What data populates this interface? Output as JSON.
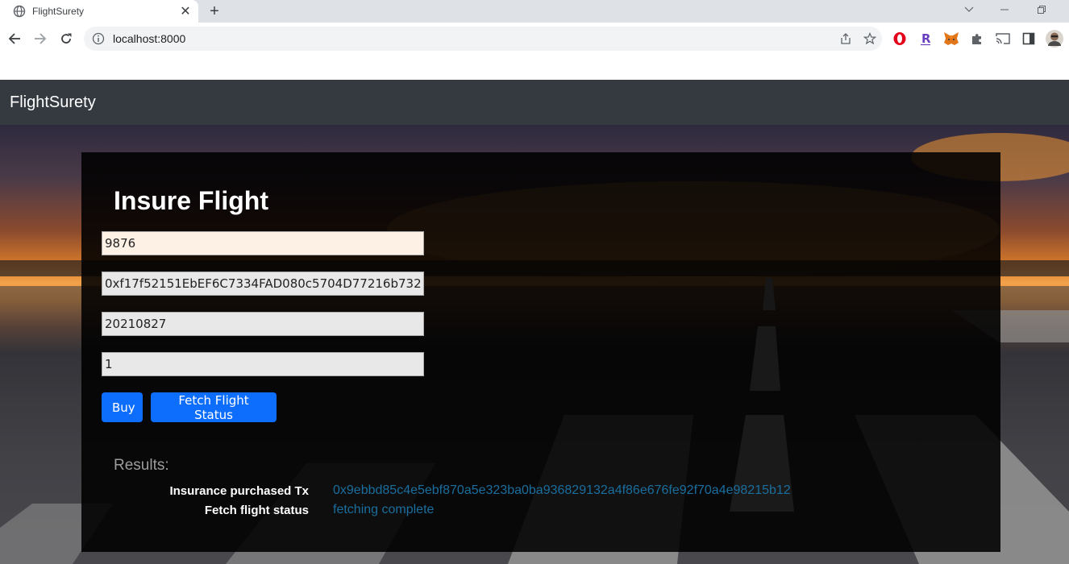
{
  "browser": {
    "tab_title": "FlightSurety",
    "url": "localhost:8000",
    "icons": [
      "globe-icon",
      "close-icon",
      "plus-icon",
      "back-icon",
      "forward-icon",
      "reload-icon",
      "info-icon",
      "share-icon",
      "star-icon",
      "opera-icon",
      "r-extension-icon",
      "metamask-icon",
      "puzzle-icon",
      "cast-icon",
      "sidepanel-icon",
      "profile-avatar"
    ]
  },
  "navbar": {
    "brand": "FlightSurety"
  },
  "form": {
    "title": "Insure Flight",
    "fields": {
      "flight": "9876",
      "airline": "0xf17f52151EbEF6C7334FAD080c5704D77216b732",
      "date": "20210827",
      "amount": "1"
    },
    "buy_label": "Buy",
    "fetch_label": "Fetch Flight Status"
  },
  "results": {
    "title": "Results:",
    "rows": [
      {
        "label": "Insurance purchased Tx",
        "value": "0x9ebbd85c4e5ebf870a5e323ba0ba936829132a4f86e676fe92f70a4e98215b12"
      },
      {
        "label": "Fetch flight status",
        "value": "fetching complete"
      }
    ]
  },
  "colors": {
    "navbar": "#343a40",
    "button": "#0d6efd",
    "result_link": "#1a6e9e"
  }
}
